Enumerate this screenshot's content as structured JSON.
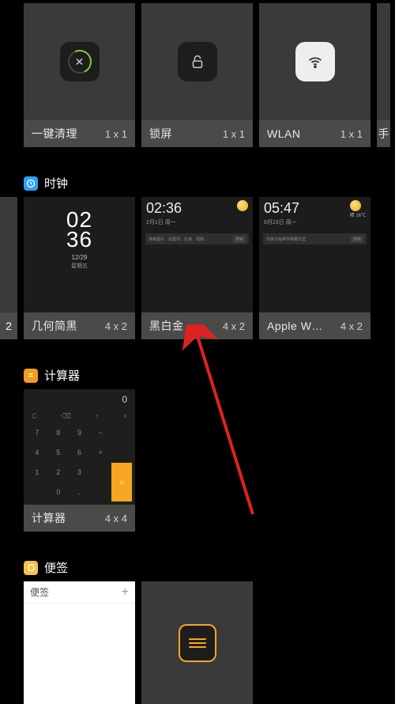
{
  "toggles": [
    {
      "name": "一键清理",
      "size": "1 x 1",
      "icon": "ring-close"
    },
    {
      "name": "锁屏",
      "size": "1 x 1",
      "icon": "lock"
    },
    {
      "name": "WLAN",
      "size": "1 x 1",
      "icon": "wifi"
    }
  ],
  "toggle_partial_right": "手",
  "sections": {
    "clock": {
      "title": "时钟",
      "icon_bg": "#2aa3ff"
    },
    "calc": {
      "title": "计算器",
      "icon_bg": "#f59b1d"
    },
    "notes": {
      "title": "便签",
      "icon_bg": "#f5c24a"
    }
  },
  "clock_partial_left": "2",
  "clock_widgets": [
    {
      "name": "几何简黑",
      "size": "4 x 2",
      "time_top": "02",
      "time_bot": "36",
      "date": "12/29",
      "day": "星期五"
    },
    {
      "name": "黑白金",
      "size": "4 x 2",
      "time": "02:36",
      "date": "2月1日 周一",
      "search": "搜索图片、设置项、应用、视频…",
      "btn": "搜索"
    },
    {
      "name": "Apple W…",
      "size": "4 x 2",
      "time": "05:47",
      "date": "8月23日 周一",
      "temp": "晴 16℃",
      "search": "你家乌龟带你称霸天堂",
      "btn": "搜索"
    }
  ],
  "calculator": {
    "name": "计算器",
    "size": "4 x 4",
    "display": "0",
    "top": [
      "C",
      "⌫",
      "÷",
      "×"
    ],
    "keys": [
      "7",
      "8",
      "9",
      "−",
      "",
      "4",
      "5",
      "6",
      "+",
      "",
      "1",
      "2",
      "3",
      "",
      "",
      "",
      "0",
      ".",
      "",
      ""
    ]
  },
  "notes_widgets": {
    "white": {
      "title": "便签",
      "plus": "+"
    },
    "dark": {}
  }
}
